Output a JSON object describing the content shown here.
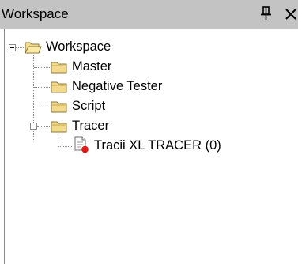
{
  "panel": {
    "title": "Workspace",
    "pin_icon": "pin-icon",
    "close_icon": "close-icon"
  },
  "tree": {
    "root": {
      "label": "Workspace",
      "icon": "open-folder-icon",
      "expanded": true
    },
    "items": [
      {
        "label": "Master",
        "icon": "folder-icon"
      },
      {
        "label": "Negative Tester",
        "icon": "folder-icon"
      },
      {
        "label": "Script",
        "icon": "folder-icon"
      },
      {
        "label": "Tracer",
        "icon": "folder-icon",
        "expanded": true,
        "children": [
          {
            "label": "Tracii XL TRACER (0)",
            "icon": "tracer-document-icon"
          }
        ]
      }
    ]
  },
  "colors": {
    "titlebar": "#c3c3c3",
    "folder": "#f3d98a",
    "status_dot": "#e21b12"
  }
}
